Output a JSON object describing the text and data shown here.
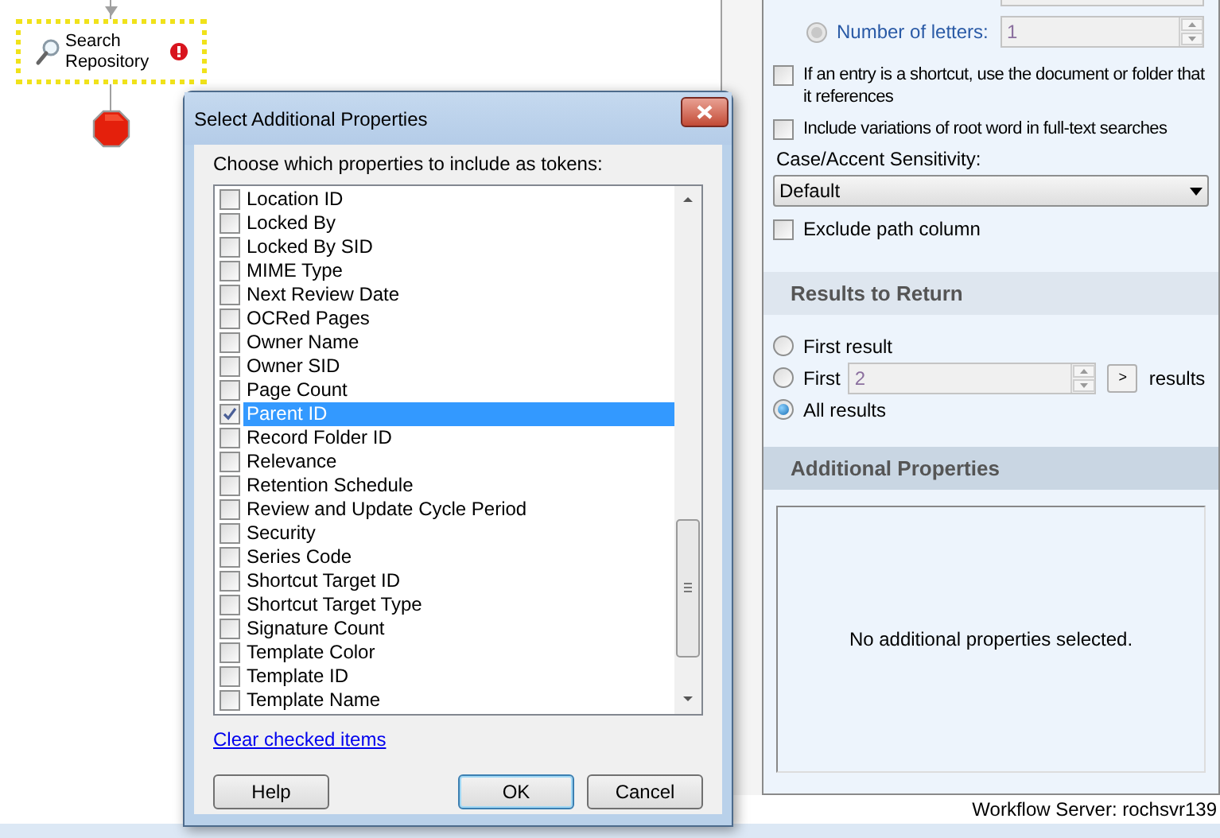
{
  "canvas": {
    "nodes": [
      {
        "kind": "activity",
        "label": "Search Repository",
        "error": true
      },
      {
        "kind": "stop"
      }
    ]
  },
  "options_panel": {
    "number_of_letters": {
      "label": "Number of letters:",
      "selected": false,
      "disabled": true,
      "value": "1"
    },
    "options": [
      {
        "label": "If an entry is a shortcut, use the document or folder that it references",
        "checked": false
      },
      {
        "label": "Include variations of root word in full-text searches",
        "checked": false
      }
    ],
    "sensitivity": {
      "label": "Case/Accent Sensitivity:",
      "value": "Default"
    },
    "exclude_path": {
      "label": "Exclude path column",
      "checked": false
    },
    "results_section": {
      "title": "Results to Return",
      "choices": [
        {
          "kind": "plain",
          "label": "First result",
          "selected": false
        },
        {
          "kind": "count",
          "label": "First",
          "value": "2",
          "button": ">",
          "suffix": "results",
          "selected": false
        },
        {
          "kind": "plain",
          "label": "All results",
          "selected": true
        }
      ]
    },
    "additional_section": {
      "title": "Additional Properties",
      "empty_message": "No additional properties selected."
    }
  },
  "status_bar": {
    "text": "Workflow Server: rochsvr139"
  },
  "dialog": {
    "title": "Select Additional Properties",
    "prompt": "Choose which properties to include as tokens:",
    "items": [
      {
        "label": "Location ID",
        "checked": false,
        "selected": false
      },
      {
        "label": "Locked By",
        "checked": false,
        "selected": false
      },
      {
        "label": "Locked By SID",
        "checked": false,
        "selected": false
      },
      {
        "label": "MIME Type",
        "checked": false,
        "selected": false
      },
      {
        "label": "Next Review Date",
        "checked": false,
        "selected": false
      },
      {
        "label": "OCRed Pages",
        "checked": false,
        "selected": false
      },
      {
        "label": "Owner Name",
        "checked": false,
        "selected": false
      },
      {
        "label": "Owner SID",
        "checked": false,
        "selected": false
      },
      {
        "label": "Page Count",
        "checked": false,
        "selected": false
      },
      {
        "label": "Parent ID",
        "checked": true,
        "selected": true
      },
      {
        "label": "Record Folder ID",
        "checked": false,
        "selected": false
      },
      {
        "label": "Relevance",
        "checked": false,
        "selected": false
      },
      {
        "label": "Retention Schedule",
        "checked": false,
        "selected": false
      },
      {
        "label": "Review and Update Cycle Period",
        "checked": false,
        "selected": false
      },
      {
        "label": "Security",
        "checked": false,
        "selected": false
      },
      {
        "label": "Series Code",
        "checked": false,
        "selected": false
      },
      {
        "label": "Shortcut Target ID",
        "checked": false,
        "selected": false
      },
      {
        "label": "Shortcut Target Type",
        "checked": false,
        "selected": false
      },
      {
        "label": "Signature Count",
        "checked": false,
        "selected": false
      },
      {
        "label": "Template Color",
        "checked": false,
        "selected": false
      },
      {
        "label": "Template ID",
        "checked": false,
        "selected": false
      },
      {
        "label": "Template Name",
        "checked": false,
        "selected": false
      }
    ],
    "link": "Clear checked items",
    "buttons": [
      {
        "label": "Help",
        "default": false
      },
      {
        "label": "OK",
        "default": true
      },
      {
        "label": "Cancel",
        "default": false
      }
    ]
  }
}
